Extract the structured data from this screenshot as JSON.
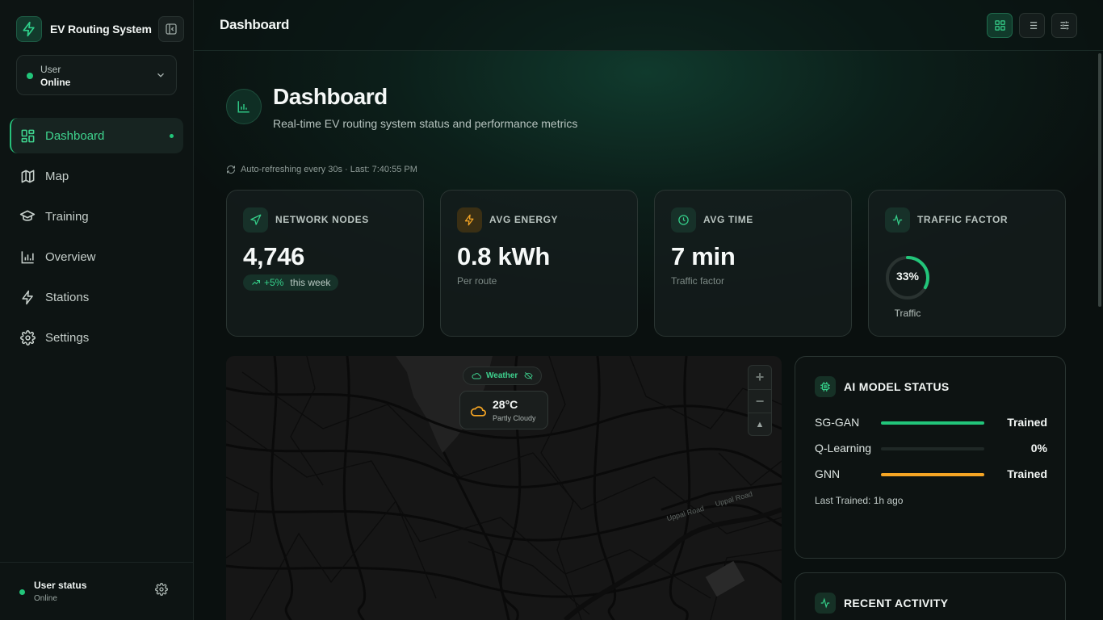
{
  "app": {
    "name": "EV Routing System"
  },
  "user_select": {
    "label": "User",
    "status": "Online"
  },
  "nav": [
    {
      "label": "Dashboard",
      "icon": "dashboard-icon",
      "active": true
    },
    {
      "label": "Map",
      "icon": "map-icon"
    },
    {
      "label": "Training",
      "icon": "graduation-cap-icon"
    },
    {
      "label": "Overview",
      "icon": "bar-chart-icon"
    },
    {
      "label": "Stations",
      "icon": "lightning-icon"
    },
    {
      "label": "Settings",
      "icon": "gear-icon"
    }
  ],
  "footer": {
    "title": "User status",
    "status": "Online"
  },
  "topbar": {
    "title": "Dashboard"
  },
  "hero": {
    "title": "Dashboard",
    "subtitle": "Real-time EV routing system status and performance metrics"
  },
  "refresh": {
    "text": "Auto-refreshing every 30s · Last: 7:40:55 PM"
  },
  "cards": {
    "nodes": {
      "title": "NETWORK NODES",
      "value": "4,746",
      "badge_value": "+5%",
      "badge_label": "this week"
    },
    "energy": {
      "title": "AVG ENERGY",
      "value": "0.8 kWh",
      "sub": "Per route"
    },
    "time": {
      "title": "AVG TIME",
      "value": "7 min",
      "sub": "Traffic factor"
    },
    "traffic": {
      "title": "TRAFFIC FACTOR",
      "value": "33%",
      "percent": 33,
      "sub": "Traffic"
    }
  },
  "map": {
    "weather_toggle": "Weather",
    "temperature": "28°C",
    "condition": "Partly Cloudy",
    "zoom_in": "+",
    "zoom_out": "−",
    "compass": "▲",
    "road_labels": [
      "Uppal Road",
      "Uppal Road"
    ]
  },
  "ai_panel": {
    "title": "AI MODEL STATUS",
    "models": [
      {
        "name": "SG-GAN",
        "status": "Trained",
        "progress": 100,
        "color": "#22c57a"
      },
      {
        "name": "Q-Learning",
        "status": "0%",
        "progress": 0,
        "color": "#22c57a"
      },
      {
        "name": "GNN",
        "status": "Trained",
        "progress": 100,
        "color": "#f5a524"
      }
    ],
    "last_trained": "Last Trained: 1h ago"
  },
  "activity_panel": {
    "title": "RECENT ACTIVITY"
  },
  "colors": {
    "accent": "#22c57a",
    "amber": "#f5a524",
    "background": "#0a0f0e"
  }
}
